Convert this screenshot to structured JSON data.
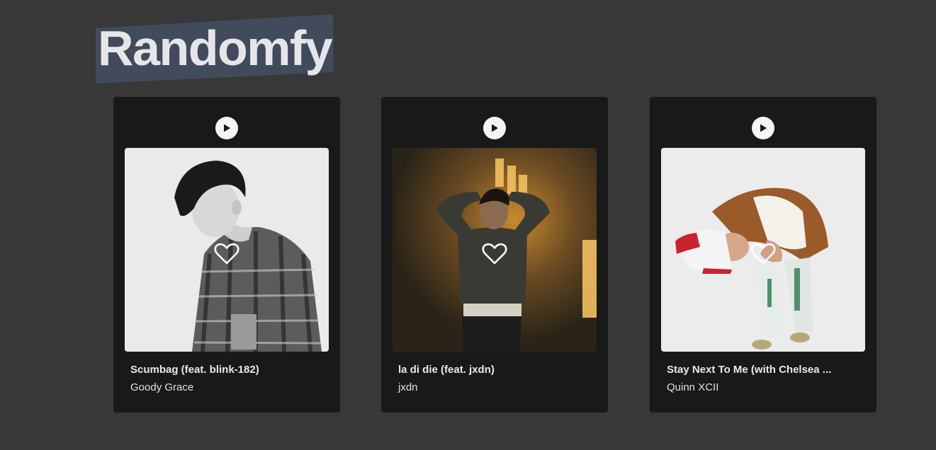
{
  "app": {
    "title": "Randomfy"
  },
  "tracks": [
    {
      "title": "Scumbag (feat. blink-182)",
      "artist": "Goody Grace",
      "cover_icon": "album-cover-photo"
    },
    {
      "title": "la di die (feat. jxdn)",
      "artist": "jxdn",
      "cover_icon": "album-cover-photo"
    },
    {
      "title": "Stay Next To Me (with Chelsea ...",
      "artist": "Quinn XCII",
      "cover_icon": "album-cover-photo"
    }
  ],
  "icons": {
    "play": "play-icon",
    "like": "heart-icon"
  },
  "colors": {
    "background": "#383838",
    "card": "#191919",
    "logo_highlight": "#424b5c",
    "text": "#e9e9e9"
  }
}
